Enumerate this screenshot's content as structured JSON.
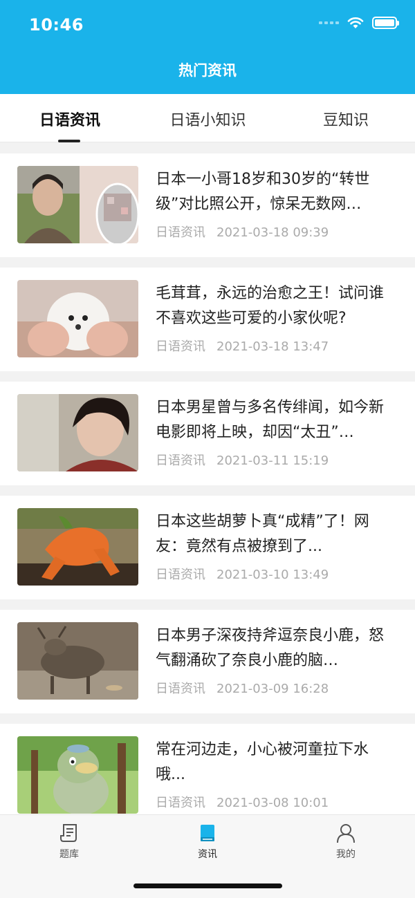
{
  "status": {
    "time": "10:46"
  },
  "header": {
    "title": "热门资讯"
  },
  "tabs": [
    {
      "label": "日语资讯",
      "active": true
    },
    {
      "label": "日语小知识",
      "active": false
    },
    {
      "label": "豆知识",
      "active": false
    }
  ],
  "articles": [
    {
      "title": "日本一小哥18岁和30岁的“转世级”对比照公开，惊呆无数网…",
      "category": "日语资讯",
      "date": "2021-03-18 09:39",
      "thumb": "comparison-photo"
    },
    {
      "title": "毛茸茸，永远的治愈之王！试问谁不喜欢这些可爱的小家伙呢?",
      "category": "日语资讯",
      "date": "2021-03-18 13:47",
      "thumb": "white-puppy"
    },
    {
      "title": "日本男星曾与多名传绯闻，如今新电影即将上映，却因“太丑”…",
      "category": "日语资讯",
      "date": "2021-03-11 15:19",
      "thumb": "actor-portrait"
    },
    {
      "title": "日本这些胡萝卜真“成精”了！网友：竟然有点被撩到了...",
      "category": "日语资讯",
      "date": "2021-03-10 13:49",
      "thumb": "carrots"
    },
    {
      "title": "日本男子深夜持斧逗奈良小鹿，怒气翻涌砍了奈良小鹿的脑…",
      "category": "日语资讯",
      "date": "2021-03-09 16:28",
      "thumb": "deer"
    },
    {
      "title": "常在河边走，小心被河童拉下水哦...",
      "category": "日语资讯",
      "date": "2021-03-08 10:01",
      "thumb": "kappa"
    }
  ],
  "bottom_nav": [
    {
      "label": "题库",
      "icon": "document-icon",
      "active": false
    },
    {
      "label": "资讯",
      "icon": "book-icon",
      "active": true
    },
    {
      "label": "我的",
      "icon": "person-icon",
      "active": false
    }
  ],
  "colors": {
    "header": "#1ab3ea",
    "active_icon": "#1ab3ea"
  }
}
